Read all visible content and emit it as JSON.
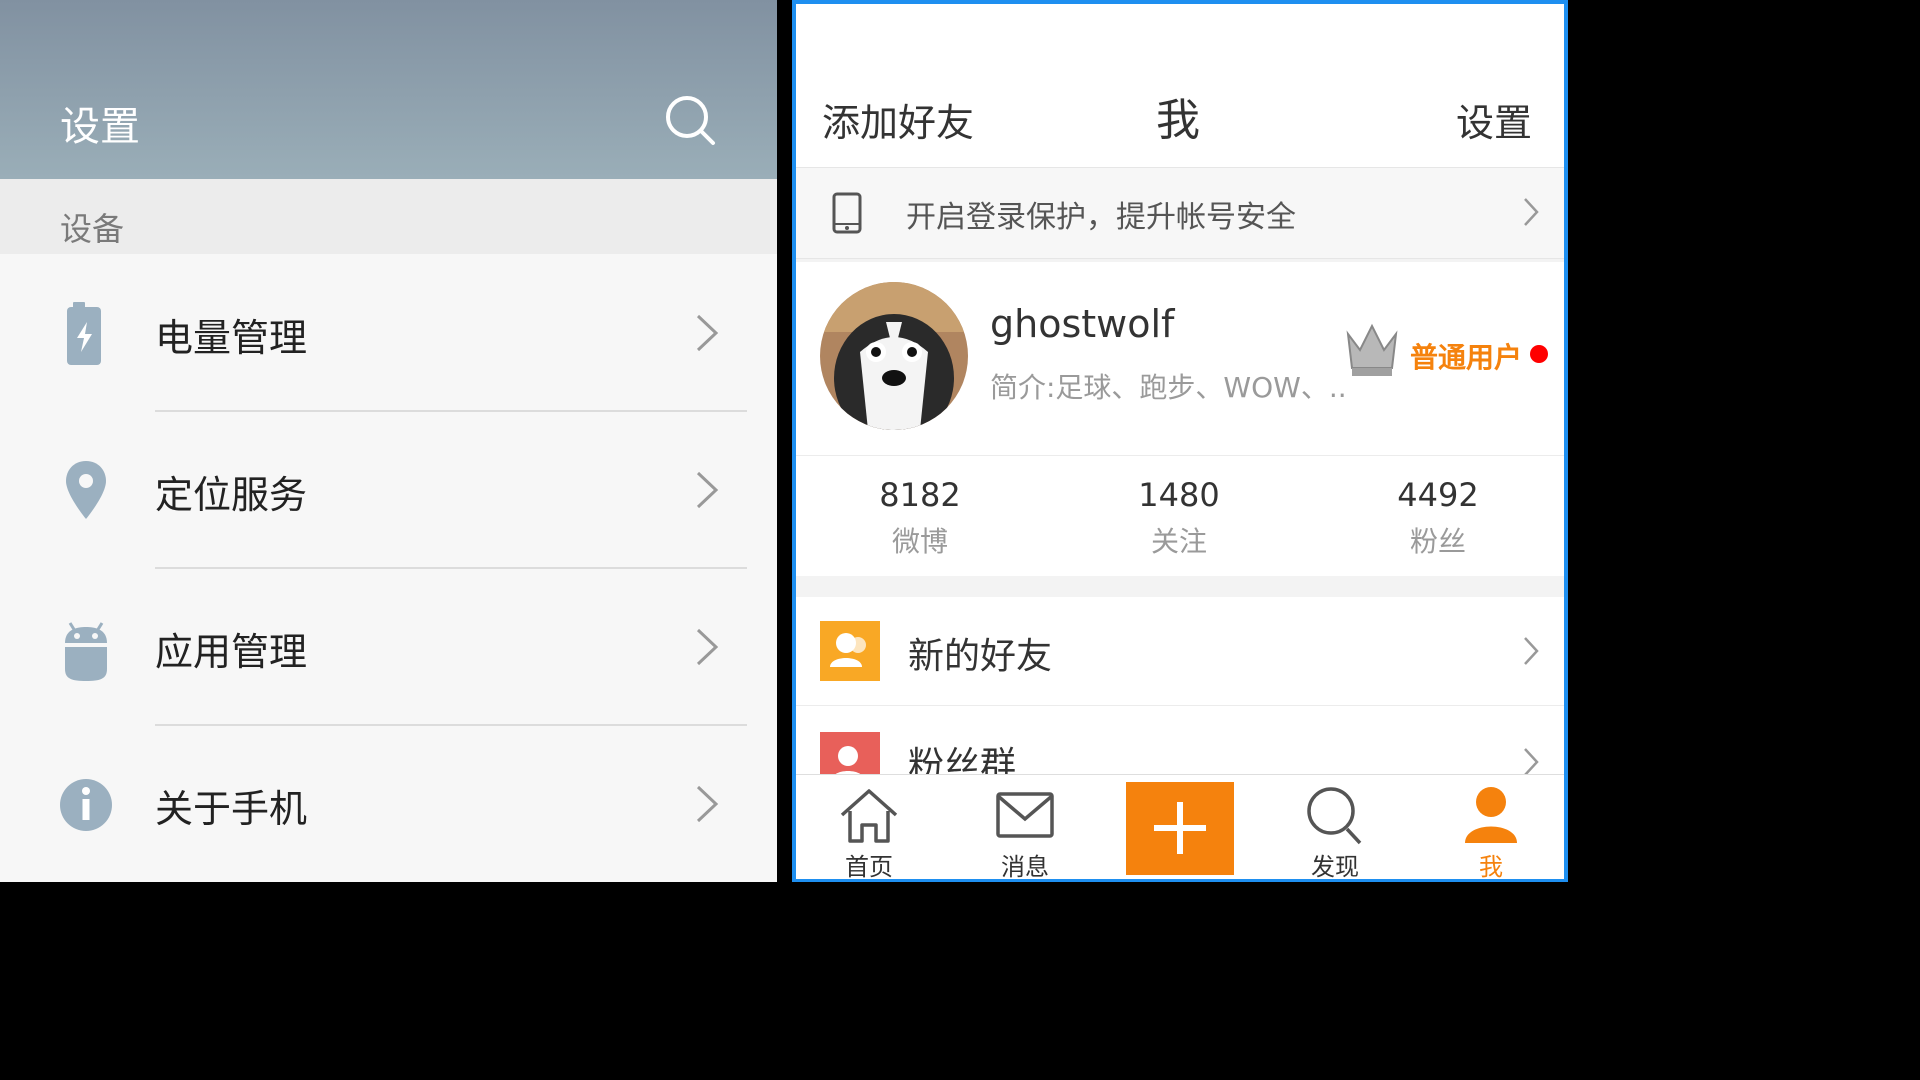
{
  "left": {
    "title": "设置",
    "section": "设备",
    "items": [
      {
        "label": "电量管理",
        "icon": "battery-icon"
      },
      {
        "label": "定位服务",
        "icon": "location-pin-icon"
      },
      {
        "label": "应用管理",
        "icon": "android-icon"
      },
      {
        "label": "关于手机",
        "icon": "info-icon"
      }
    ],
    "colors": {
      "header": "#8191a1",
      "icon": "#9bb0c0"
    }
  },
  "right": {
    "header": {
      "add_friend": "添加好友",
      "title": "我",
      "settings": "设置"
    },
    "security_prompt": "开启登录保护，提升帐号安全",
    "profile": {
      "username": "ghostwolf",
      "bio": "简介:足球、跑步、WOW、..",
      "user_type": "普通用户"
    },
    "stats": [
      {
        "value": "8182",
        "label": "微博"
      },
      {
        "value": "1480",
        "label": "关注"
      },
      {
        "value": "4492",
        "label": "粉丝"
      }
    ],
    "menu": [
      {
        "label": "新的好友",
        "icon": "new-friends-icon"
      },
      {
        "label": "粉丝群",
        "icon": "fan-group-icon"
      }
    ],
    "tabs": [
      {
        "label": "首页",
        "icon": "home-icon"
      },
      {
        "label": "消息",
        "icon": "mail-icon"
      },
      {
        "label": "",
        "icon": "plus-icon"
      },
      {
        "label": "发现",
        "icon": "search-icon"
      },
      {
        "label": "我",
        "icon": "person-icon"
      }
    ],
    "colors": {
      "accent": "#f5820d",
      "border": "#1e8ff0"
    }
  }
}
